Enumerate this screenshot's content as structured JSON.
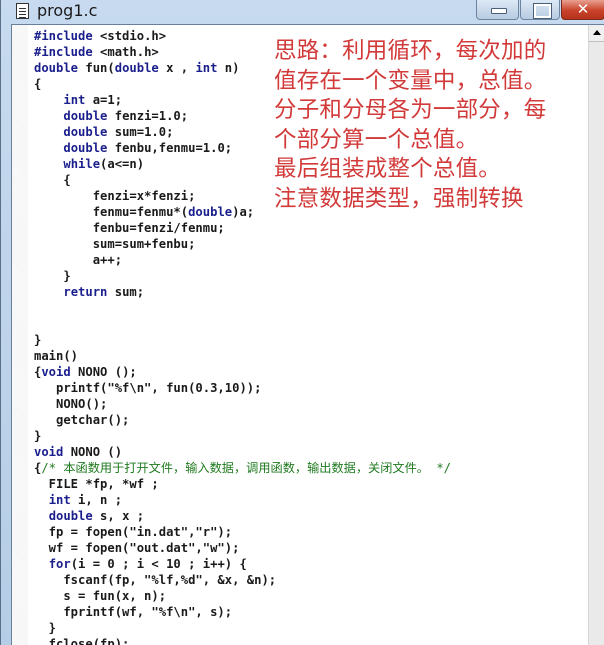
{
  "window": {
    "title": "prog1.c",
    "icon": "document-icon",
    "controls": {
      "minimize": "minimize",
      "maximize": "maximize",
      "close": "✕"
    }
  },
  "code": {
    "lines": [
      [
        {
          "t": "#include ",
          "k": "kw"
        },
        {
          "t": "<stdio.h>"
        }
      ],
      [
        {
          "t": "#include ",
          "k": "kw"
        },
        {
          "t": "<math.h>"
        }
      ],
      [
        {
          "t": "double ",
          "k": "kw"
        },
        {
          "t": "fun("
        },
        {
          "t": "double",
          "k": "kw"
        },
        {
          "t": " x , "
        },
        {
          "t": "int",
          "k": "kw"
        },
        {
          "t": " n)"
        }
      ],
      [
        {
          "t": "{"
        }
      ],
      [
        {
          "t": "    "
        },
        {
          "t": "int",
          "k": "kw"
        },
        {
          "t": " a=1;"
        }
      ],
      [
        {
          "t": "    "
        },
        {
          "t": "double",
          "k": "kw"
        },
        {
          "t": " fenzi=1.0;"
        }
      ],
      [
        {
          "t": "    "
        },
        {
          "t": "double",
          "k": "kw"
        },
        {
          "t": " sum=1.0;"
        }
      ],
      [
        {
          "t": "    "
        },
        {
          "t": "double",
          "k": "kw"
        },
        {
          "t": " fenbu,fenmu=1.0;"
        }
      ],
      [
        {
          "t": "    "
        },
        {
          "t": "while",
          "k": "kw"
        },
        {
          "t": "(a<=n)"
        }
      ],
      [
        {
          "t": "    {"
        }
      ],
      [
        {
          "t": "        fenzi=x*fenzi;"
        }
      ],
      [
        {
          "t": "        fenmu=fenmu*("
        },
        {
          "t": "double",
          "k": "kw"
        },
        {
          "t": ")a;"
        }
      ],
      [
        {
          "t": "        fenbu=fenzi/fenmu;"
        }
      ],
      [
        {
          "t": "        sum=sum+fenbu;"
        }
      ],
      [
        {
          "t": "        a++;"
        }
      ],
      [
        {
          "t": "    }"
        }
      ],
      [
        {
          "t": "    "
        },
        {
          "t": "return",
          "k": "kw"
        },
        {
          "t": " sum;"
        }
      ],
      [
        {
          "t": ""
        }
      ],
      [
        {
          "t": ""
        }
      ],
      [
        {
          "t": "}"
        }
      ],
      [
        {
          "t": "main()"
        }
      ],
      [
        {
          "t": "{"
        },
        {
          "t": "void",
          "k": "kw"
        },
        {
          "t": " NONO ();"
        }
      ],
      [
        {
          "t": "   printf(\"%f\\n\", fun(0.3,10));"
        }
      ],
      [
        {
          "t": "   NONO();"
        }
      ],
      [
        {
          "t": "   getchar();"
        }
      ],
      [
        {
          "t": "}"
        }
      ],
      [
        {
          "t": "void",
          "k": "kw"
        },
        {
          "t": " NONO ()"
        }
      ],
      [
        {
          "t": "{"
        },
        {
          "t": "/* 本函数用于打开文件，输入数据，调用函数，输出数据，关闭文件。 */",
          "k": "cm"
        }
      ],
      [
        {
          "t": "  FILE *fp, *wf ;"
        }
      ],
      [
        {
          "t": "  "
        },
        {
          "t": "int",
          "k": "kw"
        },
        {
          "t": " i, n ;"
        }
      ],
      [
        {
          "t": "  "
        },
        {
          "t": "double",
          "k": "kw"
        },
        {
          "t": " s, x ;"
        }
      ],
      [
        {
          "t": "  fp = fopen(\"in.dat\",\"r\");"
        }
      ],
      [
        {
          "t": "  wf = fopen(\"out.dat\",\"w\");"
        }
      ],
      [
        {
          "t": "  "
        },
        {
          "t": "for",
          "k": "kw"
        },
        {
          "t": "(i = 0 ; i < 10 ; i++) {"
        }
      ],
      [
        {
          "t": "    fscanf(fp, \"%lf,%d\", &x, &n);"
        }
      ],
      [
        {
          "t": "    s = fun(x, n);"
        }
      ],
      [
        {
          "t": "    fprintf(wf, \"%f\\n\", s);"
        }
      ],
      [
        {
          "t": "  }"
        }
      ],
      [
        {
          "t": "  fclose(fp);"
        }
      ]
    ]
  },
  "annotation": {
    "color": "#d23a3a",
    "lines": [
      "思路：利用循环，每次加的",
      "值存在一个变量中，总值。",
      "分子和分母各为一部分，每",
      "个部分算一个总值。",
      "最后组装成整个总值。",
      "注意数据类型，强制转换"
    ]
  }
}
